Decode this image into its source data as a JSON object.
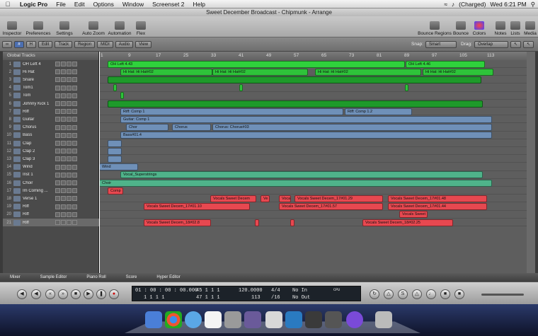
{
  "menubar": {
    "app": "Logic Pro",
    "items": [
      "File",
      "Edit",
      "Options",
      "Window",
      "Screenset 2",
      "Help"
    ],
    "battery": "(Charged)",
    "clock": "Wed 6:21 PM"
  },
  "window": {
    "title": "Sweet December Broadcast - Chipmunk - Arrange"
  },
  "toolbar": {
    "left": [
      "Inspector",
      "Preferences",
      "Settings",
      "Auto Zoom",
      "Automation",
      "Flex"
    ],
    "right": [
      "Bounce Regions",
      "Bounce",
      "Colors",
      "Notes",
      "Lists",
      "Media"
    ]
  },
  "arrange_toolbar": {
    "menus": [
      "Edit",
      "Track",
      "Region",
      "MIDI",
      "Audio",
      "View"
    ],
    "snap_label": "Snap:",
    "snap_value": "Smart",
    "drag_label": "Drag:",
    "drag_value": "Overlap"
  },
  "global_tracks": "Global Tracks",
  "ruler": [
    "1",
    "9",
    "17",
    "25",
    "33",
    "41",
    "49",
    "57",
    "65",
    "73",
    "81",
    "89",
    "97",
    "105",
    "113"
  ],
  "tracks": [
    {
      "n": "1",
      "name": "OH Left 4"
    },
    {
      "n": "2",
      "name": "Hi Hat"
    },
    {
      "n": "3",
      "name": "Snare"
    },
    {
      "n": "4",
      "name": "Tom1"
    },
    {
      "n": "5",
      "name": "Tom"
    },
    {
      "n": "6",
      "name": "Johnny Kick 1"
    },
    {
      "n": "7",
      "name": "Riff"
    },
    {
      "n": "8",
      "name": "Guitar"
    },
    {
      "n": "9",
      "name": "Chorus"
    },
    {
      "n": "10",
      "name": "Bass"
    },
    {
      "n": "11",
      "name": "Clap"
    },
    {
      "n": "12",
      "name": "Clap 2"
    },
    {
      "n": "13",
      "name": "Clap 3"
    },
    {
      "n": "14",
      "name": "Wind"
    },
    {
      "n": "15",
      "name": "Inst 1"
    },
    {
      "n": "16",
      "name": "Choir"
    },
    {
      "n": "17",
      "name": "Im Coming ..."
    },
    {
      "n": "18",
      "name": "Verse 1"
    },
    {
      "n": "19",
      "name": "Riff"
    },
    {
      "n": "20",
      "name": "Riff"
    },
    {
      "n": "21",
      "name": "Riff"
    }
  ],
  "regions": [
    {
      "lane": 0,
      "l": 12,
      "w": 420,
      "c": "#2fd23c",
      "t": "OH Left 4.43"
    },
    {
      "lane": 0,
      "l": 433,
      "w": 112,
      "c": "#2fd23c",
      "t": "OH Left 4.46"
    },
    {
      "lane": 1,
      "l": 30,
      "w": 130,
      "c": "#2ec33a",
      "t": "Hi Hat: Hi Hat#02"
    },
    {
      "lane": 1,
      "l": 160,
      "w": 135,
      "c": "#2ec33a",
      "t": "Hi Hat: Hi Hat#02"
    },
    {
      "lane": 1,
      "l": 305,
      "w": 150,
      "c": "#2ec33a",
      "t": "Hi Hat: Hi Hat#02"
    },
    {
      "lane": 1,
      "l": 457,
      "w": 100,
      "c": "#2ec33a",
      "t": "Hi Hat: Hi Hat#02"
    },
    {
      "lane": 2,
      "l": 12,
      "w": 528,
      "c": "#1e9a2a",
      "t": ""
    },
    {
      "lane": 3,
      "l": 20,
      "w": 5,
      "c": "#2ec33a",
      "t": ""
    },
    {
      "lane": 3,
      "l": 198,
      "w": 5,
      "c": "#2ec33a",
      "t": ""
    },
    {
      "lane": 3,
      "l": 432,
      "w": 5,
      "c": "#2ec33a",
      "t": ""
    },
    {
      "lane": 4,
      "l": 30,
      "w": 5,
      "c": "#2ec33a",
      "t": ""
    },
    {
      "lane": 5,
      "l": 12,
      "w": 530,
      "c": "#1e9a2a",
      "t": ""
    },
    {
      "lane": 6,
      "l": 30,
      "w": 315,
      "c": "#6f90b8",
      "t": "Riff: Comp 1"
    },
    {
      "lane": 6,
      "l": 347,
      "w": 95,
      "c": "#6f90b8",
      "t": "Riff: Comp 1.2"
    },
    {
      "lane": 7,
      "l": 30,
      "w": 525,
      "c": "#6f90b8",
      "t": "Guitar: Comp 1"
    },
    {
      "lane": 8,
      "l": 38,
      "w": 60,
      "c": "#6f90b8",
      "t": "Chor"
    },
    {
      "lane": 8,
      "l": 103,
      "w": 55,
      "c": "#6f90b8",
      "t": "Chorus"
    },
    {
      "lane": 8,
      "l": 160,
      "w": 395,
      "c": "#6f90b8",
      "t": "Chorus: Chorus#03"
    },
    {
      "lane": 9,
      "l": 30,
      "w": 525,
      "c": "#6f90b8",
      "t": "Bass#01.4"
    },
    {
      "lane": 10,
      "l": 12,
      "w": 20,
      "c": "#6f90b8",
      "t": ""
    },
    {
      "lane": 11,
      "l": 12,
      "w": 20,
      "c": "#6f90b8",
      "t": ""
    },
    {
      "lane": 12,
      "l": 12,
      "w": 20,
      "c": "#6f90b8",
      "t": ""
    },
    {
      "lane": 13,
      "l": 0,
      "w": 55,
      "c": "#6f90b8",
      "t": "Wind"
    },
    {
      "lane": 14,
      "l": 30,
      "w": 512,
      "c": "#4fb38a",
      "t": "Vocal_Superstrings"
    },
    {
      "lane": 15,
      "l": 0,
      "w": 555,
      "c": "#4fb38a",
      "t": "Choir"
    },
    {
      "lane": 16,
      "l": 12,
      "w": 22,
      "c": "#e74850",
      "t": "Comp"
    },
    {
      "lane": 17,
      "l": 157,
      "w": 65,
      "c": "#e74850",
      "t": "Vocals Sweet Decem"
    },
    {
      "lane": 17,
      "l": 228,
      "w": 13,
      "c": "#e74850",
      "t": "Ve"
    },
    {
      "lane": 17,
      "l": 254,
      "w": 17,
      "c": "#e74850",
      "t": "Voca"
    },
    {
      "lane": 17,
      "l": 276,
      "w": 125,
      "c": "#e74850",
      "t": "Vocals Sweet Decem_17#01.29"
    },
    {
      "lane": 17,
      "l": 408,
      "w": 140,
      "c": "#e74850",
      "t": "Vocals Sweet Decem_17#01.48"
    },
    {
      "lane": 18,
      "l": 63,
      "w": 150,
      "c": "#e74850",
      "t": "Vocals Sweet Decem_17#01.10"
    },
    {
      "lane": 18,
      "l": 254,
      "w": 147,
      "c": "#e74850",
      "t": "Vocals Sweet Decem_17#01.57"
    },
    {
      "lane": 18,
      "l": 408,
      "w": 140,
      "c": "#e74850",
      "t": "Vocals Sweet Decem_17#01.44"
    },
    {
      "lane": 19,
      "l": 424,
      "w": 40,
      "c": "#e74850",
      "t": "Vocals Sweet"
    },
    {
      "lane": 20,
      "l": 63,
      "w": 95,
      "c": "#e74850",
      "t": "Vocals Sweet Decem_18#02.8"
    },
    {
      "lane": 20,
      "l": 220,
      "w": 6,
      "c": "#e74850",
      "t": ""
    },
    {
      "lane": 20,
      "l": 270,
      "w": 6,
      "c": "#e74850",
      "t": ""
    },
    {
      "lane": 20,
      "l": 372,
      "w": 128,
      "c": "#e74850",
      "t": "Vocals Sweet Decem_18#02.25"
    }
  ],
  "bottom_tabs": [
    "Mixer",
    "Sample Editor",
    "Piano Roll",
    "Score",
    "Hyper Editor"
  ],
  "lcd": {
    "time": "01 : 00 : 00 : 00.000",
    "pos1": "1 1 1 1",
    "bars_a": "45 1 1 1",
    "bars_b": "47 1 1 1",
    "tempo": "120.0000",
    "tempo2": "113",
    "sig": "4/4",
    "sig2": "/16",
    "in": "No In",
    "out": "No Out",
    "cpu": "CPU"
  }
}
